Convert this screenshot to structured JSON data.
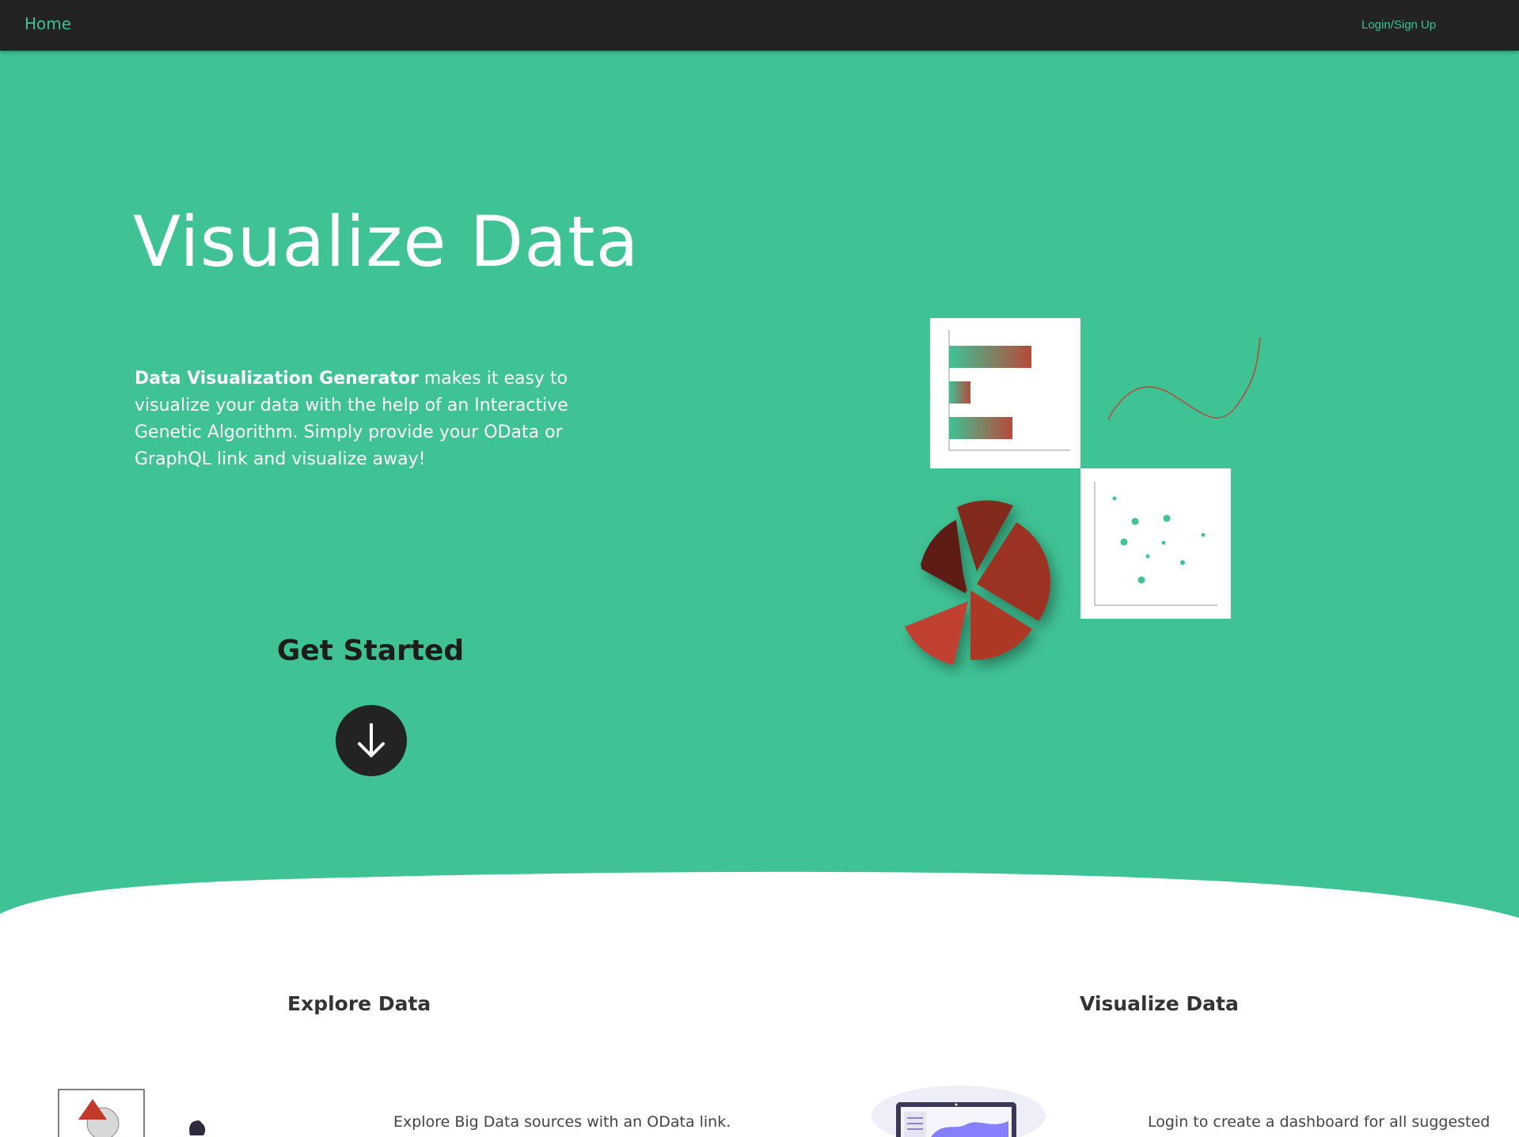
{
  "navbar": {
    "home_label": "Home",
    "login_label": "Login/Sign Up"
  },
  "hero": {
    "title": "Visualize Data",
    "description_bold": "Data Visualization Generator",
    "description_rest": " makes it easy to visualize your data with the help of an Interactive Genetic Algorithm. Simply provide your OData or GraphQL link and visualize away!",
    "cta_label": "Get Started",
    "cta_icon": "arrow-down-icon"
  },
  "features": {
    "explore": {
      "heading": "Explore Data",
      "text": "Explore Big Data sources with an OData link."
    },
    "visualize": {
      "heading": "Visualize Data",
      "text": "Login to create a dashboard for all suggested"
    }
  },
  "colors": {
    "accent": "#3fc294",
    "navbar": "#232323",
    "chart_red": "#b83a2c"
  }
}
